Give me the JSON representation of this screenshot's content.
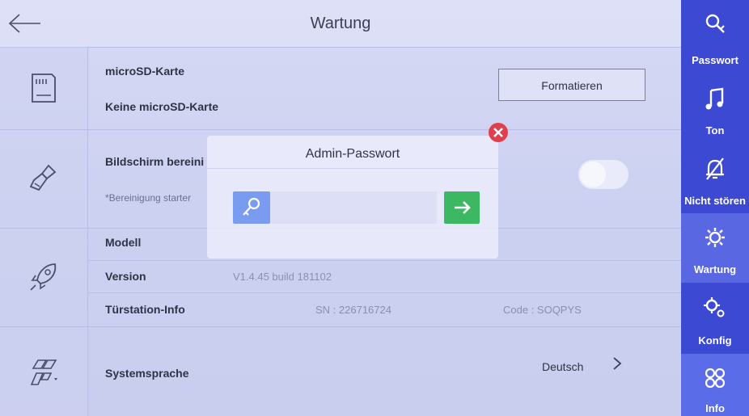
{
  "header": {
    "title": "Wartung"
  },
  "storage": {
    "title": "microSD-Karte",
    "status": "Keine microSD-Karte",
    "format_label": "Formatieren"
  },
  "screen_clean": {
    "title": "Bildschirm bereini",
    "hint": "*Bereinigung starter"
  },
  "device": {
    "model_label": "Modell",
    "version_label": "Version",
    "version_value": "V1.4.45 build 181102",
    "door_label": "Türstation-Info",
    "door_sn": "SN : 226716724",
    "door_code": "Code : SOQPYS"
  },
  "language": {
    "label": "Systemsprache",
    "value": "Deutsch"
  },
  "sidebar": {
    "items": [
      {
        "label": "Passwort",
        "icon": "key-search-icon"
      },
      {
        "label": "Ton",
        "icon": "music-note-icon"
      },
      {
        "label": "Nicht stören",
        "icon": "bell-off-icon"
      },
      {
        "label": "Wartung",
        "icon": "maintenance-gear-icon"
      },
      {
        "label": "Konfig",
        "icon": "config-gears-icon"
      },
      {
        "label": "Info",
        "icon": "info-grid-icon"
      }
    ],
    "active_index": 3
  },
  "modal": {
    "title": "Admin-Passwort",
    "password_value": "",
    "password_placeholder": ""
  },
  "colors": {
    "sidebar_bg": "#3c49d3",
    "sidebar_active": "#5968e2",
    "close_red": "#e0404e",
    "confirm_green": "#3cb862",
    "key_blue": "#7a9cf0"
  }
}
